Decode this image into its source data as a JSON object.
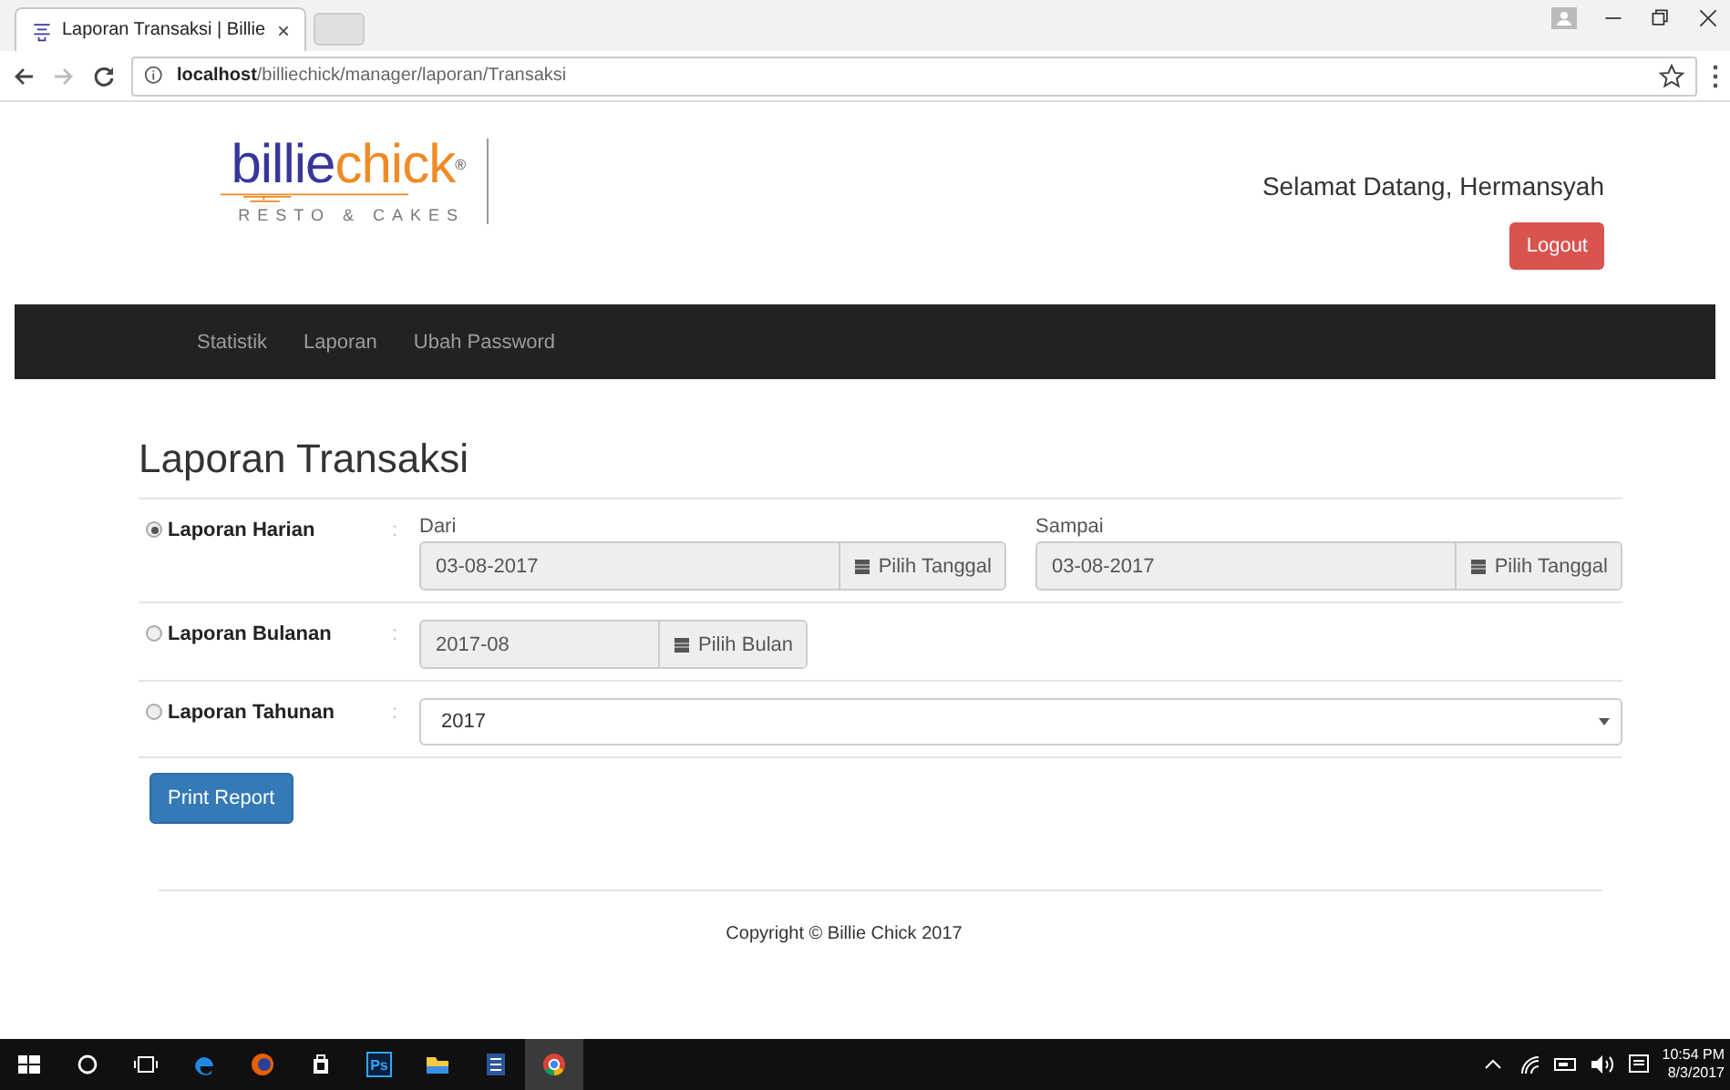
{
  "browser": {
    "tab": {
      "title": "Laporan Transaksi | Billie",
      "close": "×"
    },
    "url": "**localhost**/billiechick/manager/laporan/Transaksi"
  },
  "logo": {
    "first": "billie",
    "second": "chick",
    "mark": "®",
    "tagline": "RESTO & CAKES"
  },
  "header": {
    "greeting": "Selamat Datang, Hermansyah",
    "logout": "Logout"
  },
  "nav": [
    {
      "label": "Statistik"
    },
    {
      "label": "Laporan"
    },
    {
      "label": "Ubah Password"
    }
  ],
  "page_title": "Laporan Transaksi",
  "rows": [
    {
      "kind": "range",
      "label": "Laporan Harian",
      "selected": true,
      "separator": ":",
      "fields": [
        {
          "caption": "Dari",
          "value": "03-08-2017",
          "button": "Pilih Tanggal"
        },
        {
          "caption": "Sampai",
          "value": "03-08-2017",
          "button": "Pilih Tanggal"
        }
      ]
    },
    {
      "kind": "month",
      "label": "Laporan Bulanan",
      "selected": false,
      "separator": ":",
      "value": "2017-08",
      "button": "Pilih Bulan"
    },
    {
      "kind": "select",
      "label": "Laporan Tahunan",
      "selected": false,
      "separator": ":",
      "value": "2017"
    }
  ],
  "print_button": "Print Report",
  "footer": "Copyright © Billie Chick 2017",
  "taskbar": {
    "apps": [
      {
        "kind": "edge"
      },
      {
        "kind": "firefox"
      },
      {
        "kind": "store"
      },
      {
        "kind": "ps",
        "text": "Ps"
      },
      {
        "kind": "explorer"
      },
      {
        "kind": "word"
      },
      {
        "kind": "chrome",
        "selected": true
      }
    ],
    "time": "10:54 PM",
    "date": "8/3/2017"
  }
}
